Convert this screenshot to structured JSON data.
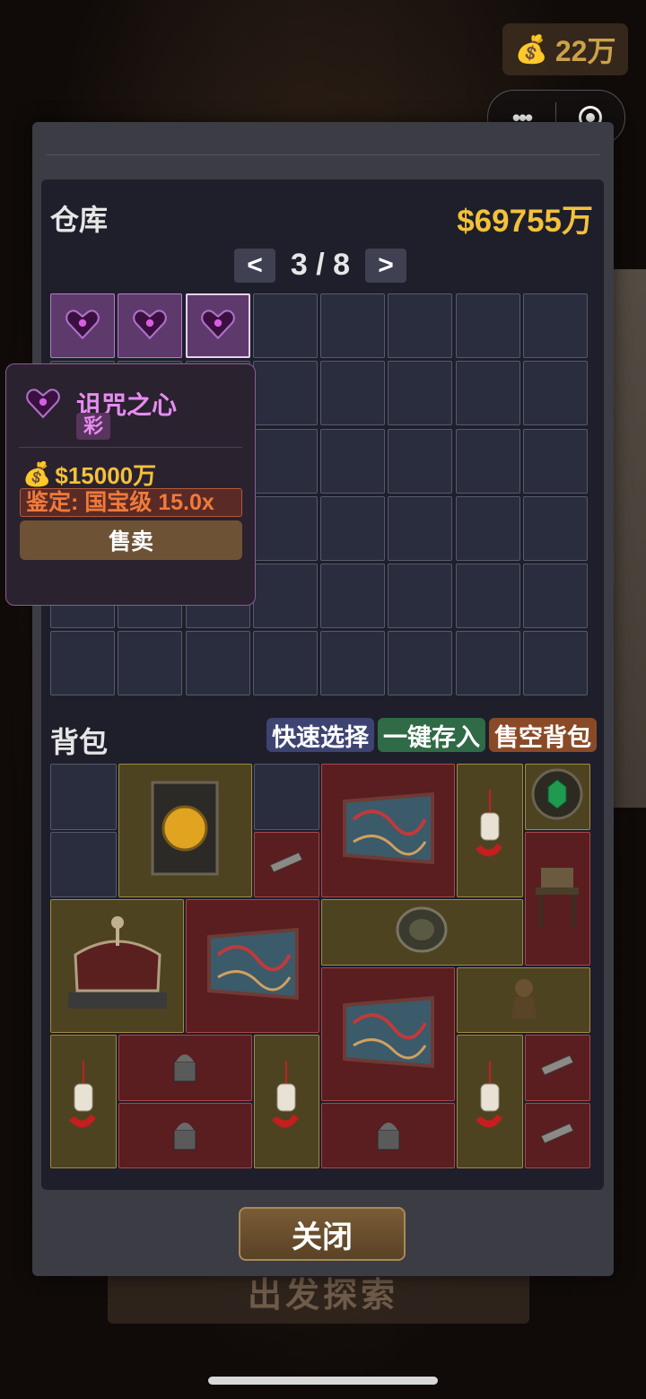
{
  "top": {
    "money_icon": "💰",
    "money": "22万"
  },
  "capsule": {
    "more": "•••",
    "close_icon": "target-icon"
  },
  "background": {
    "ghost_button": "出发探索"
  },
  "warehouse": {
    "title": "仓库",
    "money": "$69755万",
    "pager": {
      "prev": "<",
      "page": "3 / 8",
      "next": ">"
    }
  },
  "bag": {
    "title": "背包",
    "buttons": {
      "quick_select": "快速选择",
      "deposit_all": "一键存入",
      "sell_all": "售空背包"
    }
  },
  "tooltip": {
    "name": "诅咒之心",
    "rarity": "彩",
    "price_icon": "💰",
    "price": "$15000万",
    "appraisal": "鉴定: 国宝级 15.0x",
    "sell": "售卖"
  },
  "close": "关闭",
  "colors": {
    "gold": "#f3c13a",
    "purple_text": "#e88cf2",
    "appraisal": "#f07a3a"
  }
}
